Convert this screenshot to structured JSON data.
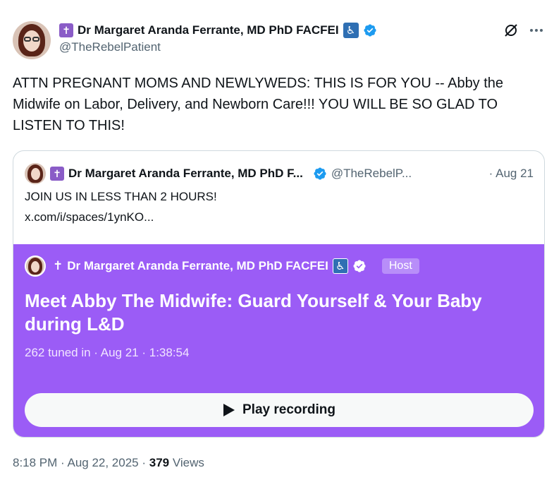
{
  "author": {
    "name": "Dr Margaret Aranda Ferrante, MD PhD FACFEI",
    "handle": "@TheRebelPatient",
    "cross_glyph": "✝",
    "accessibility_glyph": "♿",
    "verified_icon": "verified-badge-icon",
    "accent_color": "#1d9bf0"
  },
  "tweet": {
    "text": "ATTN PREGNANT MOMS AND NEWLYWEDS: THIS IS FOR YOU -- Abby the Midwife on Labor, Delivery, and Newborn Care!!! YOU WILL BE SO GLAD TO LISTEN TO THIS!"
  },
  "quote": {
    "name": "Dr Margaret Aranda Ferrante, MD PhD F...",
    "handle": "@TheRebelP...",
    "date": "· Aug 21",
    "line1": "JOIN US IN LESS THAN 2 HOURS!",
    "line2": "x.com/i/spaces/1ynKO..."
  },
  "space": {
    "host_name": "Dr Margaret Aranda Ferrante, MD PhD FACFEI",
    "host_tag": "Host",
    "title": "Meet Abby The Midwife: Guard Yourself & Your Baby during L&D",
    "meta": "262 tuned in · Aug 21 · 1:38:54",
    "play_label": "Play recording",
    "background_color": "#9b5cf6"
  },
  "footer": {
    "time": "8:18 PM · Aug 22, 2025 · ",
    "views_count": "379",
    "views_label": " Views"
  },
  "icons": {
    "grok": "grok-icon",
    "more": "more-icon",
    "play": "play-icon"
  }
}
